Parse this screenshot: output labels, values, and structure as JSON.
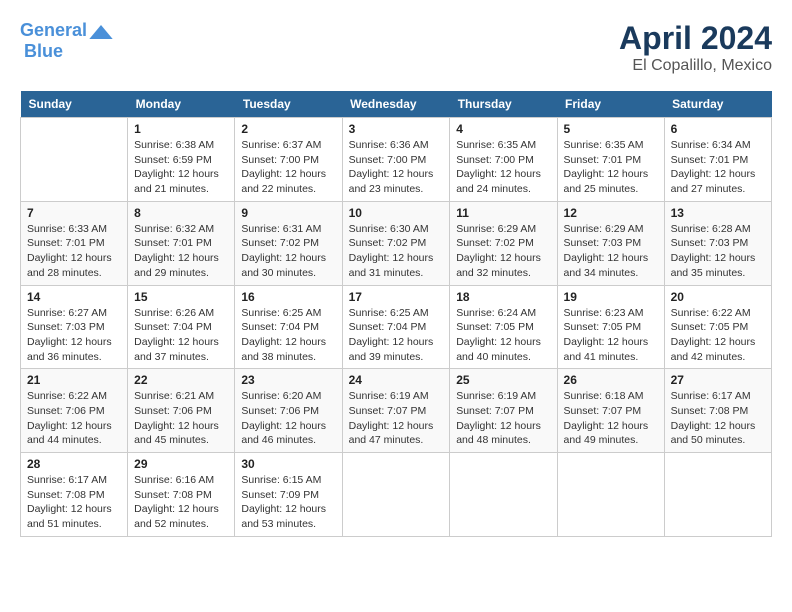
{
  "header": {
    "logo_line1": "General",
    "logo_line2": "Blue",
    "month": "April 2024",
    "location": "El Copalillo, Mexico"
  },
  "days_of_week": [
    "Sunday",
    "Monday",
    "Tuesday",
    "Wednesday",
    "Thursday",
    "Friday",
    "Saturday"
  ],
  "weeks": [
    [
      {
        "day": "",
        "info": ""
      },
      {
        "day": "1",
        "info": "Sunrise: 6:38 AM\nSunset: 6:59 PM\nDaylight: 12 hours\nand 21 minutes."
      },
      {
        "day": "2",
        "info": "Sunrise: 6:37 AM\nSunset: 7:00 PM\nDaylight: 12 hours\nand 22 minutes."
      },
      {
        "day": "3",
        "info": "Sunrise: 6:36 AM\nSunset: 7:00 PM\nDaylight: 12 hours\nand 23 minutes."
      },
      {
        "day": "4",
        "info": "Sunrise: 6:35 AM\nSunset: 7:00 PM\nDaylight: 12 hours\nand 24 minutes."
      },
      {
        "day": "5",
        "info": "Sunrise: 6:35 AM\nSunset: 7:01 PM\nDaylight: 12 hours\nand 25 minutes."
      },
      {
        "day": "6",
        "info": "Sunrise: 6:34 AM\nSunset: 7:01 PM\nDaylight: 12 hours\nand 27 minutes."
      }
    ],
    [
      {
        "day": "7",
        "info": "Sunrise: 6:33 AM\nSunset: 7:01 PM\nDaylight: 12 hours\nand 28 minutes."
      },
      {
        "day": "8",
        "info": "Sunrise: 6:32 AM\nSunset: 7:01 PM\nDaylight: 12 hours\nand 29 minutes."
      },
      {
        "day": "9",
        "info": "Sunrise: 6:31 AM\nSunset: 7:02 PM\nDaylight: 12 hours\nand 30 minutes."
      },
      {
        "day": "10",
        "info": "Sunrise: 6:30 AM\nSunset: 7:02 PM\nDaylight: 12 hours\nand 31 minutes."
      },
      {
        "day": "11",
        "info": "Sunrise: 6:29 AM\nSunset: 7:02 PM\nDaylight: 12 hours\nand 32 minutes."
      },
      {
        "day": "12",
        "info": "Sunrise: 6:29 AM\nSunset: 7:03 PM\nDaylight: 12 hours\nand 34 minutes."
      },
      {
        "day": "13",
        "info": "Sunrise: 6:28 AM\nSunset: 7:03 PM\nDaylight: 12 hours\nand 35 minutes."
      }
    ],
    [
      {
        "day": "14",
        "info": "Sunrise: 6:27 AM\nSunset: 7:03 PM\nDaylight: 12 hours\nand 36 minutes."
      },
      {
        "day": "15",
        "info": "Sunrise: 6:26 AM\nSunset: 7:04 PM\nDaylight: 12 hours\nand 37 minutes."
      },
      {
        "day": "16",
        "info": "Sunrise: 6:25 AM\nSunset: 7:04 PM\nDaylight: 12 hours\nand 38 minutes."
      },
      {
        "day": "17",
        "info": "Sunrise: 6:25 AM\nSunset: 7:04 PM\nDaylight: 12 hours\nand 39 minutes."
      },
      {
        "day": "18",
        "info": "Sunrise: 6:24 AM\nSunset: 7:05 PM\nDaylight: 12 hours\nand 40 minutes."
      },
      {
        "day": "19",
        "info": "Sunrise: 6:23 AM\nSunset: 7:05 PM\nDaylight: 12 hours\nand 41 minutes."
      },
      {
        "day": "20",
        "info": "Sunrise: 6:22 AM\nSunset: 7:05 PM\nDaylight: 12 hours\nand 42 minutes."
      }
    ],
    [
      {
        "day": "21",
        "info": "Sunrise: 6:22 AM\nSunset: 7:06 PM\nDaylight: 12 hours\nand 44 minutes."
      },
      {
        "day": "22",
        "info": "Sunrise: 6:21 AM\nSunset: 7:06 PM\nDaylight: 12 hours\nand 45 minutes."
      },
      {
        "day": "23",
        "info": "Sunrise: 6:20 AM\nSunset: 7:06 PM\nDaylight: 12 hours\nand 46 minutes."
      },
      {
        "day": "24",
        "info": "Sunrise: 6:19 AM\nSunset: 7:07 PM\nDaylight: 12 hours\nand 47 minutes."
      },
      {
        "day": "25",
        "info": "Sunrise: 6:19 AM\nSunset: 7:07 PM\nDaylight: 12 hours\nand 48 minutes."
      },
      {
        "day": "26",
        "info": "Sunrise: 6:18 AM\nSunset: 7:07 PM\nDaylight: 12 hours\nand 49 minutes."
      },
      {
        "day": "27",
        "info": "Sunrise: 6:17 AM\nSunset: 7:08 PM\nDaylight: 12 hours\nand 50 minutes."
      }
    ],
    [
      {
        "day": "28",
        "info": "Sunrise: 6:17 AM\nSunset: 7:08 PM\nDaylight: 12 hours\nand 51 minutes."
      },
      {
        "day": "29",
        "info": "Sunrise: 6:16 AM\nSunset: 7:08 PM\nDaylight: 12 hours\nand 52 minutes."
      },
      {
        "day": "30",
        "info": "Sunrise: 6:15 AM\nSunset: 7:09 PM\nDaylight: 12 hours\nand 53 minutes."
      },
      {
        "day": "",
        "info": ""
      },
      {
        "day": "",
        "info": ""
      },
      {
        "day": "",
        "info": ""
      },
      {
        "day": "",
        "info": ""
      }
    ]
  ]
}
